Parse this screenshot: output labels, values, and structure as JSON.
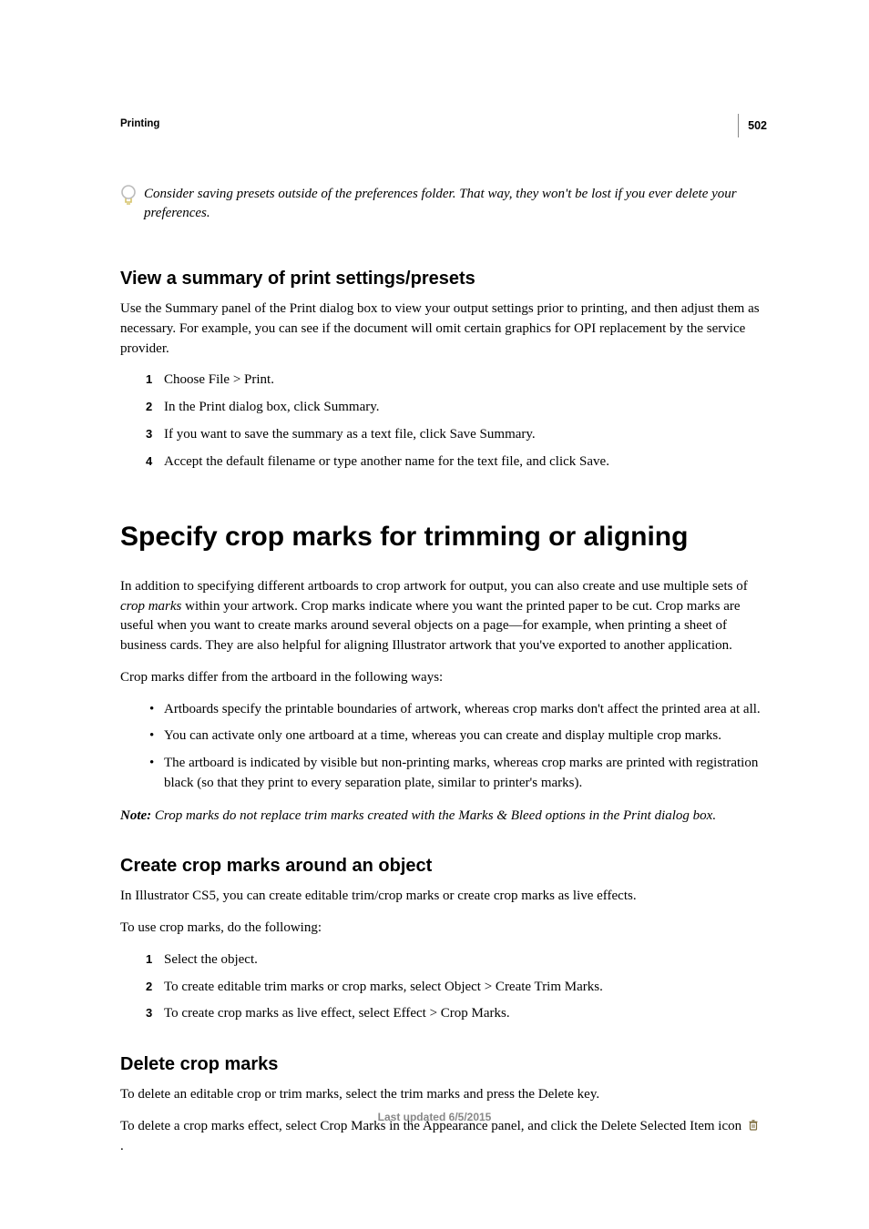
{
  "page_number": "502",
  "section_label": "Printing",
  "tip": "Consider saving presets outside of the preferences folder. That way, they won't be lost if you ever delete your preferences.",
  "h2_a": "View a summary of print settings/presets",
  "para_a": "Use the Summary panel of the Print dialog box to view your output settings prior to printing, and then adjust them as necessary. For example, you can see if the document will omit certain graphics for OPI replacement by the service provider.",
  "ol_a": {
    "n1": "1",
    "t1": "Choose File > Print.",
    "n2": "2",
    "t2": "In the Print dialog box, click Summary.",
    "n3": "3",
    "t3": "If you want to save the summary as a text file, click Save Summary.",
    "n4": "4",
    "t4": "Accept the default filename or type another name for the text file, and click Save."
  },
  "h1": "Specify crop marks for trimming or aligning",
  "para_b_pre": "In addition to specifying different artboards to crop artwork for output, you can also create and use multiple sets of ",
  "para_b_em": "crop marks",
  "para_b_post": " within your artwork. Crop marks indicate where you want the printed paper to be cut. Crop marks are useful when you want to create marks around several objects on a page—for example, when printing a sheet of business cards. They are also helpful for aligning Illustrator artwork that you've exported to another application.",
  "para_c": "Crop marks differ from the artboard in the following ways:",
  "ul_a": {
    "t1": "Artboards specify the printable boundaries of artwork, whereas crop marks don't affect the printed area at all.",
    "t2": "You can activate only one artboard at a time, whereas you can create and display multiple crop marks.",
    "t3": "The artboard is indicated by visible but non-printing marks, whereas crop marks are printed with registration black (so that they print to every separation plate, similar to printer's marks)."
  },
  "note_label": "Note: ",
  "note_text": "Crop marks do not replace trim marks created with the Marks & Bleed options in the Print dialog box.",
  "h2_b": "Create crop marks around an object",
  "para_d": "In Illustrator CS5, you can create editable trim/crop marks or create crop marks as live effects.",
  "para_e": "To use crop marks, do the following:",
  "ol_b": {
    "n1": "1",
    "t1": "Select the object.",
    "n2": "2",
    "t2": "To create editable trim marks or crop marks, select Object > Create Trim Marks.",
    "n3": "3",
    "t3": "To create crop marks as live effect, select Effect > Crop Marks."
  },
  "h2_c": "Delete crop marks",
  "para_f": "To delete an editable crop or trim marks, select the trim marks and press the Delete key.",
  "para_g_pre": "To delete a crop marks effect, select Crop Marks in the Appearance panel, and click the Delete Selected Item icon ",
  "para_g_post": " .",
  "footer": "Last updated 6/5/2015"
}
